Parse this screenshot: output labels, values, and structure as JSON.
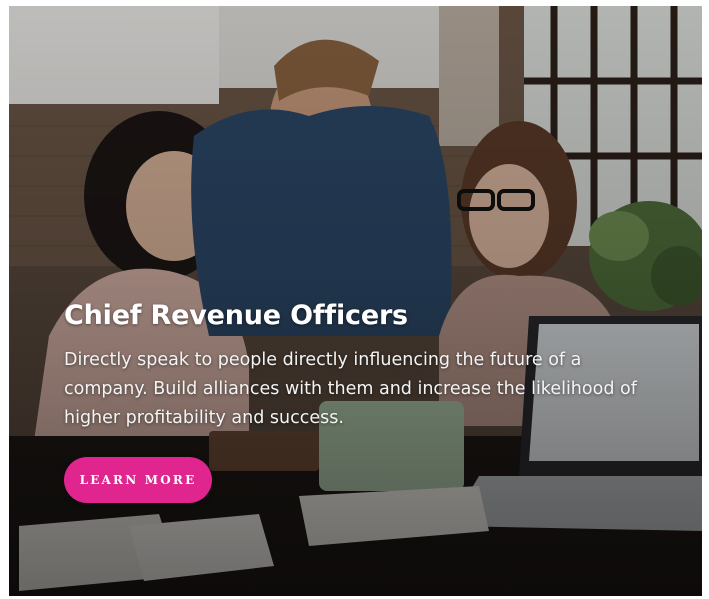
{
  "card": {
    "title": "Chief Revenue Officers",
    "description": "Directly speak to people directly influencing the future of a company. Build alliances with them and increase the likelihood of higher profitability and success.",
    "button_label": "LEARN MORE"
  },
  "colors": {
    "accent": "#e0258f",
    "text": "#ffffff"
  }
}
